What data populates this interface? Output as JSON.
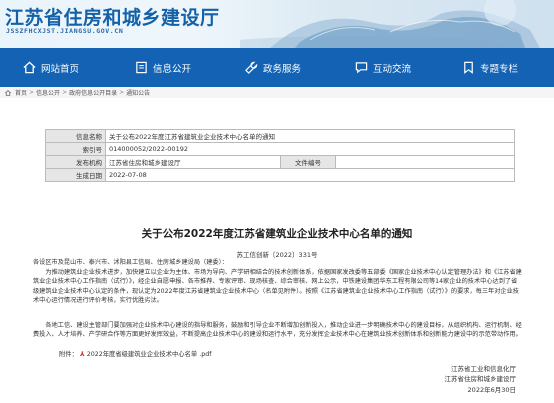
{
  "banner": {
    "title": "江苏省住房和城乡建设厅",
    "domain": "JSSZFHCXJST.JIANGSU.GOV.CN"
  },
  "nav": [
    {
      "label": "网站首页",
      "icon": "home-icon"
    },
    {
      "label": "信息公开",
      "icon": "book-icon"
    },
    {
      "label": "政务服务",
      "icon": "wrench-icon"
    },
    {
      "label": "互动交流",
      "icon": "chat-icon"
    },
    {
      "label": "专题专栏",
      "icon": "bookmark-icon"
    }
  ],
  "breadcrumb": {
    "items": [
      "首页",
      "信息公开",
      "政府信息公开目录",
      "通知公告"
    ],
    "sep": ">"
  },
  "info": {
    "title_label": "信息名称",
    "title_value": "关于公布2022年度江苏省建筑业企业技术中心名单的通知",
    "index_label": "索引号",
    "index_value": "014000052/2022-00192",
    "publisher_label": "发布机构",
    "publisher_value": "江苏省住房和城乡建设厅",
    "docno_label": "文件编号",
    "docno_value": "",
    "date_label": "生成日期",
    "date_value": "2022-07-08"
  },
  "doc": {
    "title": "关于公布2022年度江苏省建筑业企业技术中心名单的通知",
    "number": "苏工信创新〔2022〕331号",
    "p1": "各设区市及昆山市、泰兴市、沭阳县工信局、住房城乡建设局（建委）：",
    "p2": "为推动建筑业企业技术进步，加快建立以企业为主体、市场为导向、产学研相结合的技术创新体系，依据国家发改委等五部委《国家企业技术中心认定管理办法》和《江苏省建筑业企业技术中心工作指南（试行）》，经企业自愿申报、各市推荐、专家评审、现场核查、综合审核、网上公示，中铁建设集团华东工程有限公司等14家企业的技术中心达到了省级建筑业企业技术中心认定的条件，现认定为2022年度江苏省建筑业企业技术中心（名单见附件）。按照《江苏省建筑业企业技术中心工作指南（试行）》的要求，每三年对企业技术中心运行情况进行评价考核，实行优胜劣汰。",
    "p3": "各地工信、建设主管部门要加强对企业技术中心建设的指导和服务，鼓励和引导企业不断增加创新投入，推动企业进一步明确技术中心的建设目标，从组织机构、运行机制、经费投入、人才培养、产学研合作等方面更好发挥效益，不断提高企业技术中心的建设和运行水平，充分发挥企业技术中心在建筑业技术创新体系和创新能力建设中的示范带动作用。",
    "attach_prefix": "附件：",
    "attach_file": "2022年度省级建筑业企业技术中心名单 .pdf",
    "sign1": "江苏省工业和信息化厅",
    "sign2": "江苏省住房和城乡建设厅",
    "sign_date": "2022年6月30日"
  }
}
